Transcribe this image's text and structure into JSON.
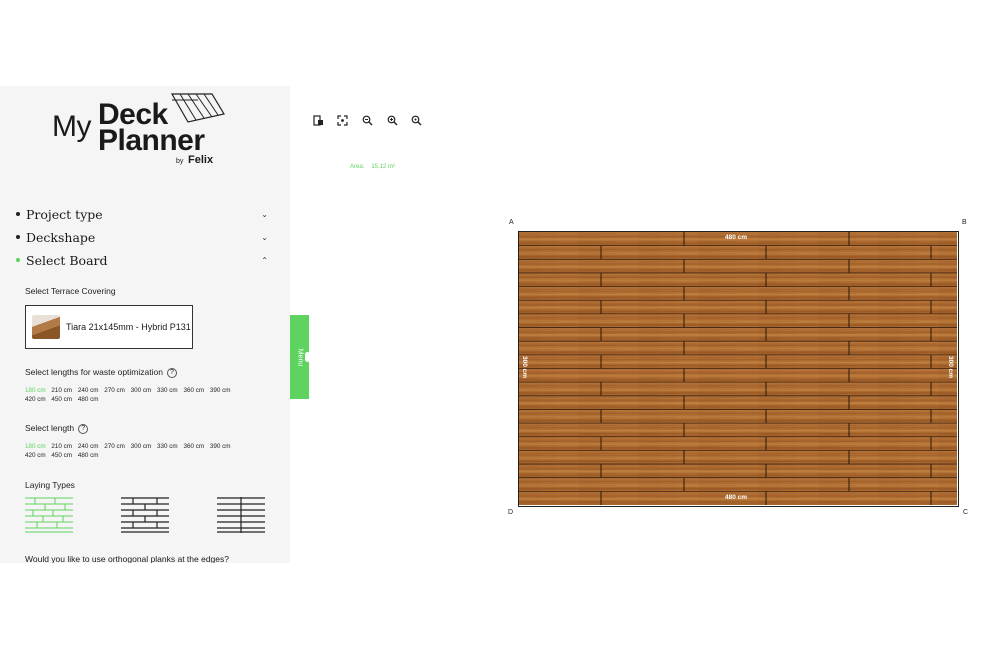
{
  "logo": {
    "my": "My",
    "deck": "Deck",
    "planner": "Planner",
    "by": "by",
    "felix": "Felix"
  },
  "sidebar": {
    "sections": [
      {
        "label": "Project type",
        "expanded": false
      },
      {
        "label": "Deckshape",
        "expanded": false
      },
      {
        "label": "Select Board",
        "expanded": true
      }
    ],
    "terrace_title": "Select Terrace Covering",
    "board_name": "Tiara 21x145mm - Hybrid P131",
    "waste_title": "Select lengths for waste optimization",
    "lengths_waste": [
      "180 cm",
      "210 cm",
      "240 cm",
      "270 cm",
      "300 cm",
      "330 cm",
      "360 cm",
      "390 cm",
      "420 cm",
      "450 cm",
      "480 cm"
    ],
    "length_title": "Select length",
    "lengths": [
      "180 cm",
      "210 cm",
      "240 cm",
      "270 cm",
      "300 cm",
      "330 cm",
      "360 cm",
      "390 cm",
      "420 cm",
      "450 cm",
      "480 cm"
    ],
    "laying_title": "Laying Types",
    "orthogonal_question": "Would you like to use orthogonal planks at the edges?"
  },
  "menu_tab": "Menu",
  "toolbar": {
    "icons": [
      "export-icon",
      "fit-screen-icon",
      "zoom-out-icon",
      "zoom-in-icon",
      "zoom-reset-icon"
    ]
  },
  "area": {
    "label": "Area:",
    "value": "15,12 m²"
  },
  "deck": {
    "corners": {
      "a": "A",
      "b": "B",
      "c": "C",
      "d": "D"
    },
    "dim_top": "480 cm",
    "dim_bottom": "480 cm",
    "dim_left": "300 cm",
    "dim_right": "300 cm"
  },
  "colors": {
    "accent": "#5fd35f",
    "wood": "#a9652c"
  }
}
